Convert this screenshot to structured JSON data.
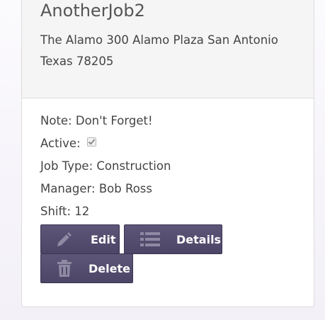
{
  "job": {
    "title": "AnotherJob2",
    "address": "The Alamo 300 Alamo Plaza San Antonio Texas 78205"
  },
  "details": {
    "note": "Note: Don't Forget!",
    "active_label": "Active:",
    "active_checked": true,
    "job_type": "Job Type: Construction",
    "manager": "Manager: Bob Ross",
    "shift": "Shift: 12"
  },
  "actions": {
    "edit_label": "Edit",
    "details_label": "Details",
    "delete_label": "Delete",
    "edit_icon": "pencil-icon",
    "details_icon": "list-icon",
    "delete_icon": "trash-icon"
  },
  "colors": {
    "button_bg": "#524b6d",
    "icon_gray": "#8f8aa3"
  }
}
